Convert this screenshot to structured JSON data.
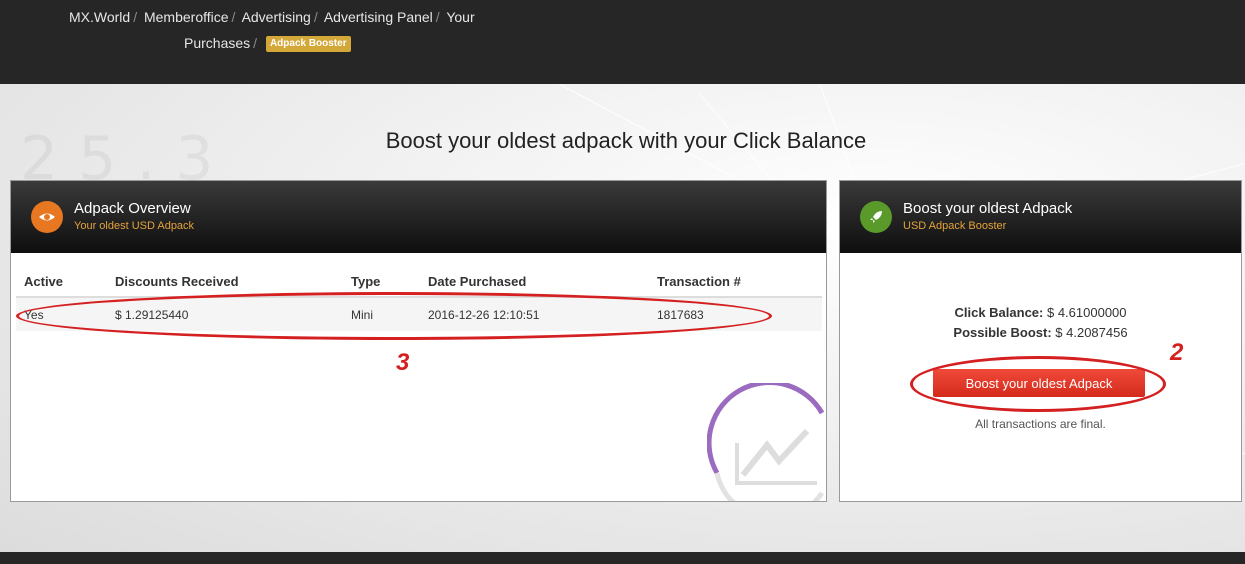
{
  "breadcrumb": {
    "items": [
      "MX.World",
      "Memberoffice",
      "Advertising",
      "Advertising Panel",
      "Your"
    ],
    "items_line2": [
      "Purchases"
    ],
    "current_badge": "Adpack Booster"
  },
  "page": {
    "title": "Boost your oldest adpack with your Click Balance"
  },
  "overview": {
    "title": "Adpack Overview",
    "subtitle": "Your oldest USD Adpack",
    "columns": [
      "Active",
      "Discounts Received",
      "Type",
      "Date Purchased",
      "Transaction #"
    ],
    "rows": [
      [
        "Yes",
        "$ 1.29125440",
        "Mini",
        "2016-12-26 12:10:51",
        "1817683"
      ]
    ]
  },
  "booster": {
    "title": "Boost your oldest Adpack",
    "subtitle": "USD Adpack Booster",
    "click_balance_label": "Click Balance:",
    "click_balance_value": "$ 4.61000000",
    "possible_boost_label": "Possible Boost:",
    "possible_boost_value": "$ 4.2087456",
    "button_label": "Boost your oldest Adpack",
    "note": "All transactions are final."
  },
  "annotations": {
    "label_table": "3",
    "label_button": "2"
  },
  "colors": {
    "topbar": "#262626",
    "badge": "#d4a838",
    "subtitle_orange": "#e5a33a",
    "button_red": "#e63a2c",
    "annotation_red": "#d42020",
    "eye_icon_bg": "#e87722",
    "rocket_icon_bg": "#5a9a2a"
  },
  "icons": {
    "overview": "eye-icon",
    "booster": "rocket-icon"
  }
}
